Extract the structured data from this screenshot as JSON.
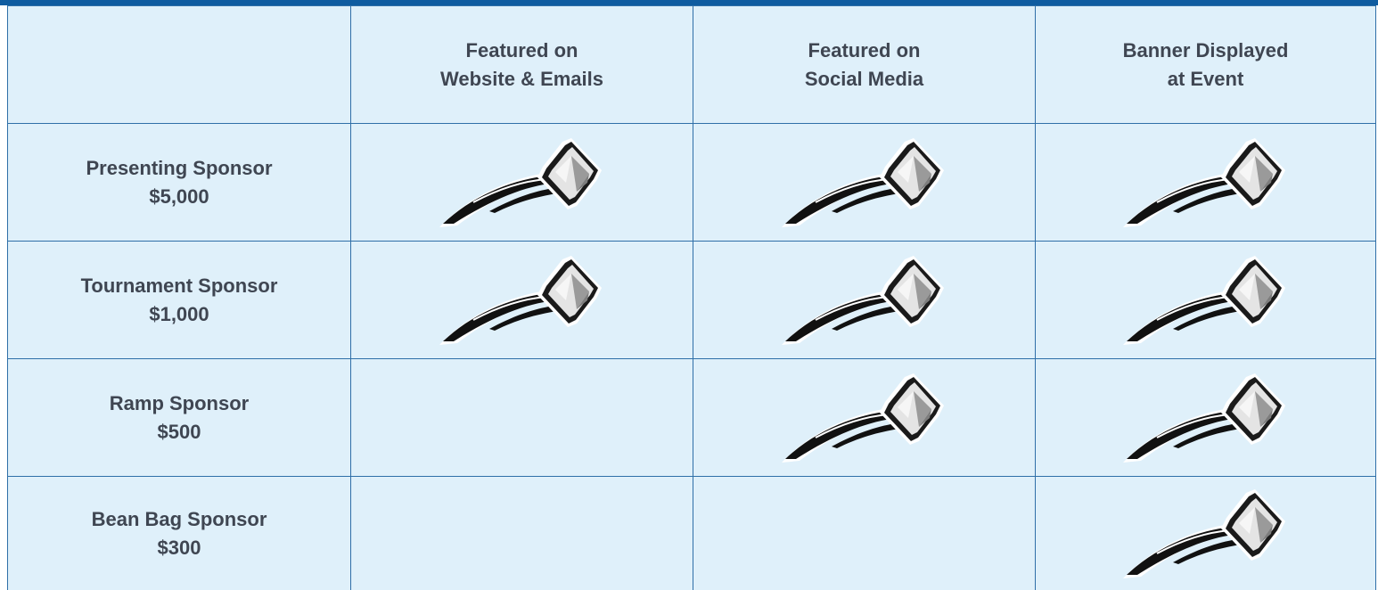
{
  "header": {
    "corner": "",
    "columns": [
      "Featured on\nWebsite & Emails",
      "Featured on\nSocial Media",
      "Banner Displayed\nat Event"
    ]
  },
  "rows": [
    {
      "name": "Presenting Sponsor",
      "price": "$5,000",
      "benefits": [
        true,
        true,
        true
      ]
    },
    {
      "name": "Tournament Sponsor",
      "price": "$1,000",
      "benefits": [
        true,
        true,
        true
      ]
    },
    {
      "name": "Ramp Sponsor",
      "price": "$500",
      "benefits": [
        false,
        true,
        true
      ]
    },
    {
      "name": "Bean Bag Sponsor",
      "price": "$300",
      "benefits": [
        false,
        false,
        true
      ]
    }
  ],
  "icon": "flying-bean-bag-icon",
  "colors": {
    "accent_bar": "#0f5ca0",
    "cell_background": "#dff0fa",
    "grid_line": "#2f6fa8",
    "text": "#3f4652"
  }
}
